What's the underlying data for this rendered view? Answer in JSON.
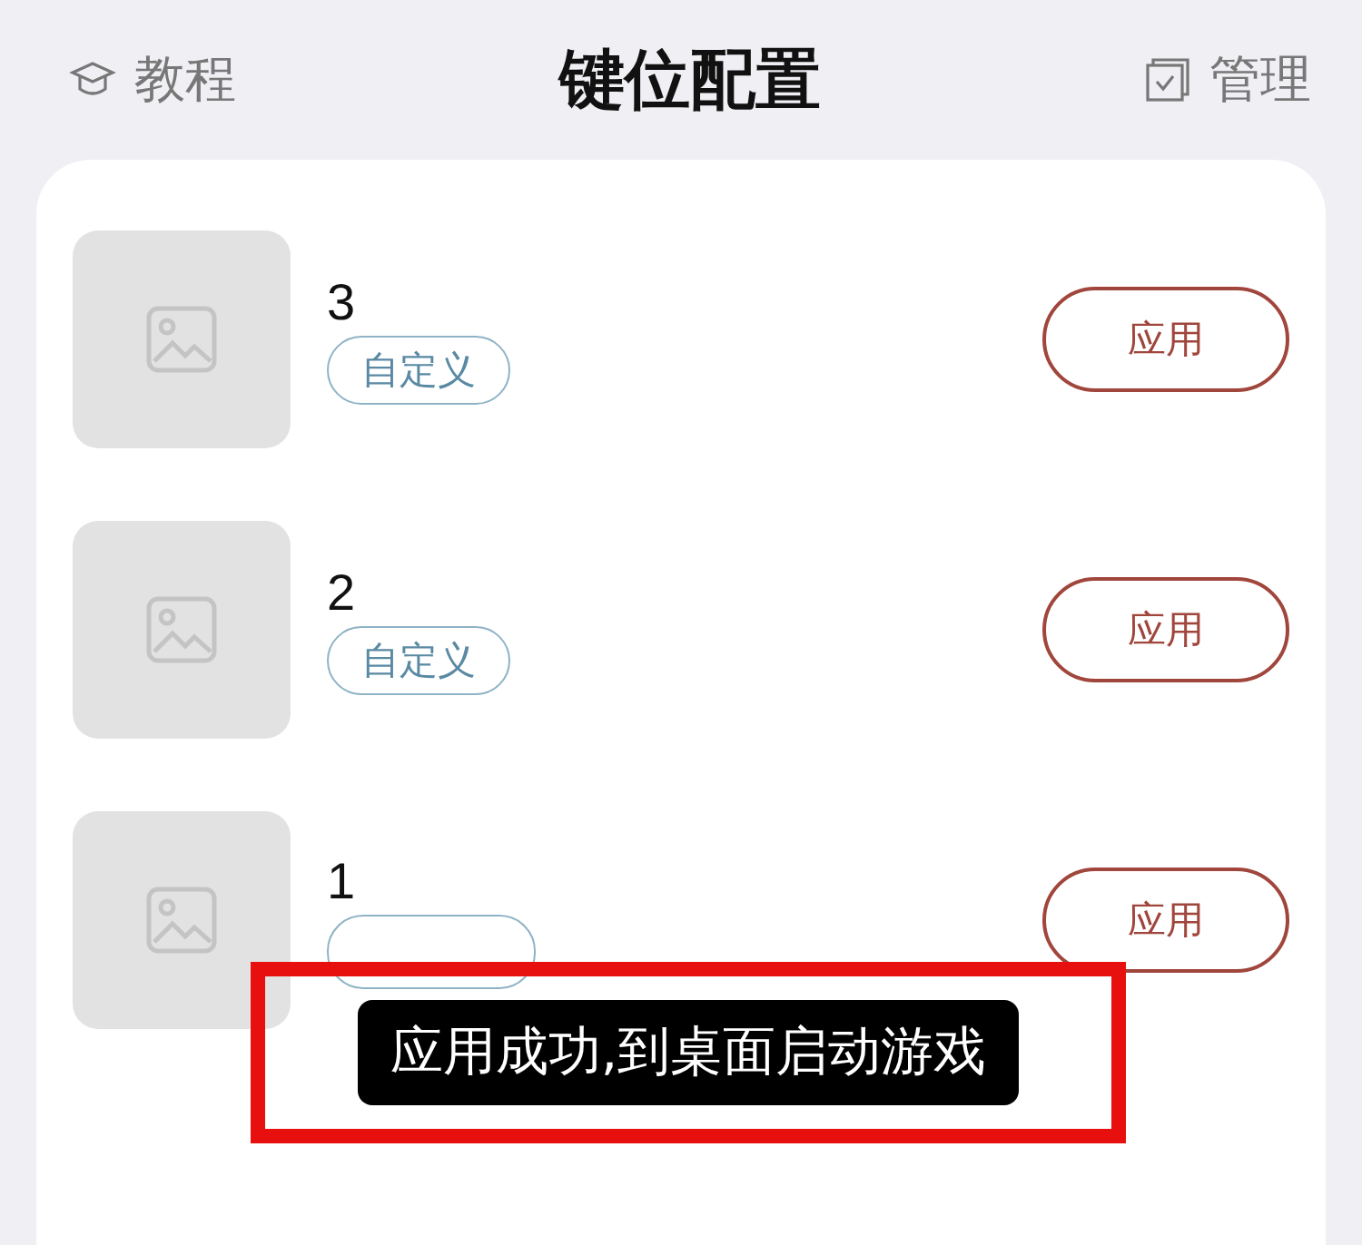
{
  "header": {
    "left": {
      "label": "教程"
    },
    "title": "键位配置",
    "right": {
      "label": "管理"
    }
  },
  "configs": [
    {
      "name": "3",
      "tag": "自定义",
      "button": "应用"
    },
    {
      "name": "2",
      "tag": "自定义",
      "button": "应用"
    },
    {
      "name": "1",
      "button": "应用"
    }
  ],
  "toast": {
    "text": "应用成功,到桌面启动游戏",
    "highlighted": true
  }
}
